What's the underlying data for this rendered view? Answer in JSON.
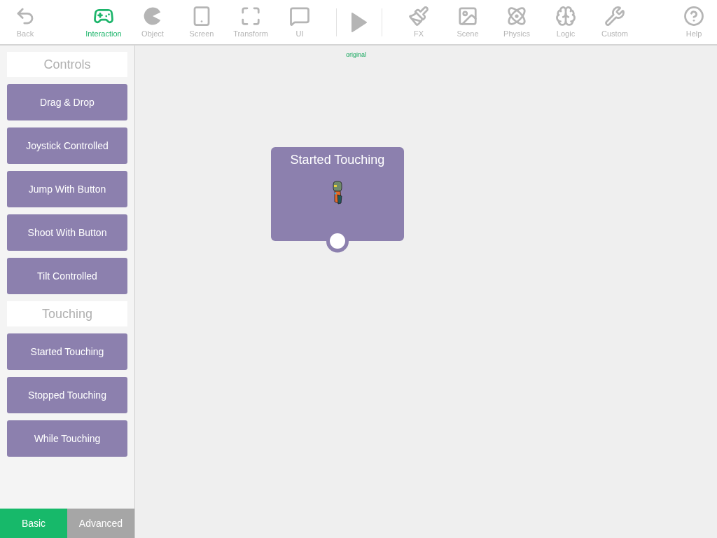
{
  "toolbar": {
    "tools": [
      {
        "label": "Back",
        "kind": "tool",
        "selected": false
      },
      {
        "label": "Interaction",
        "kind": "tool",
        "selected": true
      },
      {
        "label": "Object",
        "kind": "tool",
        "selected": false
      },
      {
        "label": "Screen",
        "kind": "tool",
        "selected": false
      },
      {
        "label": "Transform",
        "kind": "tool",
        "selected": false
      },
      {
        "label": "UI",
        "kind": "tool",
        "selected": false
      },
      {
        "kind": "play"
      },
      {
        "label": "FX",
        "kind": "tool",
        "selected": false
      },
      {
        "label": "Scene",
        "kind": "tool",
        "selected": false
      },
      {
        "label": "Physics",
        "kind": "tool",
        "selected": false
      },
      {
        "label": "Logic",
        "kind": "tool",
        "selected": false
      },
      {
        "label": "Custom",
        "kind": "tool",
        "selected": false
      },
      {
        "label": "Help",
        "kind": "tool",
        "selected": false
      }
    ]
  },
  "sidebar": {
    "sections": [
      {
        "title": "Controls",
        "items": [
          "Drag & Drop",
          "Joystick Controlled",
          "Jump With Button",
          "Shoot With Button",
          "Tilt Controlled"
        ]
      },
      {
        "title": "Touching",
        "items": [
          "Started Touching",
          "Stopped Touching",
          "While Touching"
        ]
      }
    ],
    "tabs": [
      {
        "label": "Basic",
        "selected": true
      },
      {
        "label": "Advanced",
        "selected": false
      }
    ]
  },
  "canvas": {
    "object_label": "original",
    "node": {
      "title": "Started Touching"
    }
  }
}
